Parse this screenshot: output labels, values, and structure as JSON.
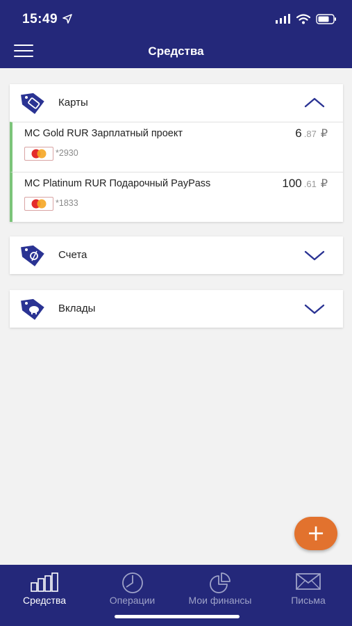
{
  "status_bar": {
    "time": "15:49"
  },
  "header": {
    "title": "Средства"
  },
  "sections": [
    {
      "label": "Карты",
      "expanded": true,
      "cards": [
        {
          "name": "MC Gold RUR Зарплатный проект",
          "amount_main": "6",
          "amount_cents": ".87",
          "currency": "₽",
          "number": "*2930"
        },
        {
          "name": "MC Platinum RUR Подарочный PayPass",
          "amount_main": "100",
          "amount_cents": ".61",
          "currency": "₽",
          "number": "*1833"
        }
      ]
    },
    {
      "label": "Счета",
      "expanded": false
    },
    {
      "label": "Вклады",
      "expanded": false
    }
  ],
  "fab": {
    "icon": "plus-icon",
    "label": "+"
  },
  "tabs": [
    {
      "label": "Средства",
      "icon": "bar-chart-icon",
      "active": true
    },
    {
      "label": "Операции",
      "icon": "clock-icon",
      "active": false
    },
    {
      "label": "Мои финансы",
      "icon": "pie-chart-icon",
      "active": false
    },
    {
      "label": "Письма",
      "icon": "envelope-icon",
      "active": false
    }
  ],
  "colors": {
    "brand": "#24287a",
    "accent": "#e2722e",
    "card_stripe": "#7cc47a"
  }
}
